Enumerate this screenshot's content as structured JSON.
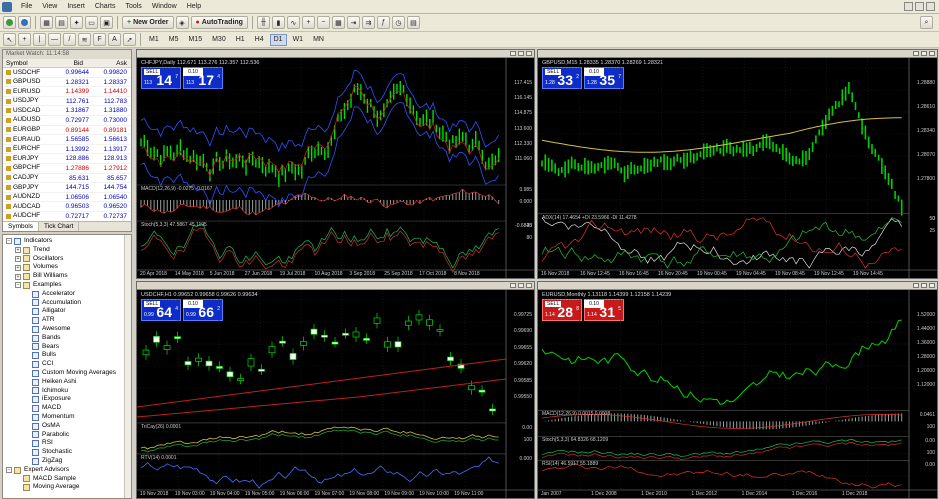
{
  "menu": [
    "File",
    "View",
    "Insert",
    "Charts",
    "Tools",
    "Window",
    "Help"
  ],
  "toolbar": {
    "new_order": "New Order",
    "autotrading": "AutoTrading"
  },
  "timeframes": [
    "M1",
    "M5",
    "M15",
    "M30",
    "H1",
    "H4",
    "D1",
    "W1",
    "MN"
  ],
  "timeframe_active": "D1",
  "market_watch": {
    "title": "Market Watch: 11:14:58",
    "col_symbol": "Symbol",
    "col_bid": "Bid",
    "col_ask": "Ask",
    "rows": [
      {
        "s": "USDCHF",
        "b": "0.99644",
        "a": "0.99820",
        "c": "#0000c0"
      },
      {
        "s": "GBPUSD",
        "b": "1.28321",
        "a": "1.28337",
        "c": "#0000c0"
      },
      {
        "s": "EURUSD",
        "b": "1.14399",
        "a": "1.14410",
        "c": "#d00000"
      },
      {
        "s": "USDJPY",
        "b": "112.761",
        "a": "112.783",
        "c": "#0000c0"
      },
      {
        "s": "USDCAD",
        "b": "1.31867",
        "a": "1.31880",
        "c": "#0000c0"
      },
      {
        "s": "AUDUSD",
        "b": "0.72977",
        "a": "0.73000",
        "c": "#0000c0"
      },
      {
        "s": "EURGBP",
        "b": "0.89144",
        "a": "0.89181",
        "c": "#d00000"
      },
      {
        "s": "EURAUD",
        "b": "1.56585",
        "a": "1.56613",
        "c": "#0000c0"
      },
      {
        "s": "EURCHF",
        "b": "1.13992",
        "a": "1.13917",
        "c": "#0000c0"
      },
      {
        "s": "EURJPY",
        "b": "128.886",
        "a": "128.913",
        "c": "#0000c0"
      },
      {
        "s": "GBPCHF",
        "b": "1.27886",
        "a": "1.27912",
        "c": "#d00000"
      },
      {
        "s": "CADJPY",
        "b": "85.631",
        "a": "85.657",
        "c": "#0000c0"
      },
      {
        "s": "GBPJPY",
        "b": "144.715",
        "a": "144.754",
        "c": "#0000c0"
      },
      {
        "s": "AUDNZD",
        "b": "1.06506",
        "a": "1.06540",
        "c": "#0000c0"
      },
      {
        "s": "AUDCAD",
        "b": "0.96503",
        "a": "0.96520",
        "c": "#0000c0"
      },
      {
        "s": "AUDCHF",
        "b": "0.72717",
        "a": "0.72737",
        "c": "#0000c0"
      }
    ],
    "tabs": [
      "Symbols",
      "Tick Chart"
    ]
  },
  "navigator": {
    "items": [
      {
        "t": "Indicators",
        "lvl": 0,
        "box": "-",
        "ind": true
      },
      {
        "t": "Trend",
        "lvl": 1,
        "box": "+"
      },
      {
        "t": "Oscillators",
        "lvl": 1,
        "box": "+"
      },
      {
        "t": "Volumes",
        "lvl": 1,
        "box": "+"
      },
      {
        "t": "Bill Williams",
        "lvl": 1,
        "box": "+"
      },
      {
        "t": "Examples",
        "lvl": 1,
        "box": "-"
      },
      {
        "t": "Accelerator",
        "lvl": 2,
        "ind": true
      },
      {
        "t": "Accumulation",
        "lvl": 2,
        "ind": true
      },
      {
        "t": "Alligator",
        "lvl": 2,
        "ind": true
      },
      {
        "t": "ATR",
        "lvl": 2,
        "ind": true
      },
      {
        "t": "Awesome",
        "lvl": 2,
        "ind": true
      },
      {
        "t": "Bands",
        "lvl": 2,
        "ind": true
      },
      {
        "t": "Bears",
        "lvl": 2,
        "ind": true
      },
      {
        "t": "Bulls",
        "lvl": 2,
        "ind": true
      },
      {
        "t": "CCI",
        "lvl": 2,
        "ind": true
      },
      {
        "t": "Custom Moving Averages",
        "lvl": 2,
        "ind": true
      },
      {
        "t": "Heiken Ashi",
        "lvl": 2,
        "ind": true
      },
      {
        "t": "Ichimoku",
        "lvl": 2,
        "ind": true
      },
      {
        "t": "iExposure",
        "lvl": 2,
        "ind": true
      },
      {
        "t": "MACD",
        "lvl": 2,
        "ind": true
      },
      {
        "t": "Momentum",
        "lvl": 2,
        "ind": true
      },
      {
        "t": "OsMA",
        "lvl": 2,
        "ind": true
      },
      {
        "t": "Parabolic",
        "lvl": 2,
        "ind": true
      },
      {
        "t": "RSI",
        "lvl": 2,
        "ind": true
      },
      {
        "t": "Stochastic",
        "lvl": 2,
        "ind": true
      },
      {
        "t": "ZigZag",
        "lvl": 2,
        "ind": true
      },
      {
        "t": "Expert Advisors",
        "lvl": 0,
        "box": "-"
      },
      {
        "t": "MACD Sample",
        "lvl": 1
      },
      {
        "t": "Moving Average",
        "lvl": 1
      }
    ]
  },
  "charts": [
    {
      "id": "chfjpy",
      "symbol": "CHFJPY,Daily  112.671 113.276 112.357 112.536",
      "sell_label": "SELL",
      "buy_label": "BUY",
      "lot": "0.10",
      "sell_small": "113",
      "sell_big": "14",
      "sell_sup": "7",
      "buy_small": "113",
      "buy_big": "17",
      "buy_sup": "4",
      "red": false,
      "ind1": "MACD(12,26,9) -0.0275 -0.0167",
      "ind2": "Stoch(5,3,3) 47.5867 45.1195",
      "y": [
        "117.415",
        "116.145",
        "114.875",
        "113.600",
        "112.330",
        "111.060"
      ],
      "x": [
        "20 Apr 2018",
        "14 May 2018",
        "5 Jun 2018",
        "27 Jun 2018",
        "19 Jul 2018",
        "10 Aug 2018",
        "3 Sep 2018",
        "25 Sep 2018",
        "17 Oct 2018",
        "8 Nov 2018"
      ],
      "ind_y": [
        "0.985",
        "0.000",
        "-0.6845",
        "80",
        "20"
      ]
    },
    {
      "id": "gbpusd",
      "symbol": "GBPUSD,M15  1.28335 1.28370 1.28269 1.28321",
      "sell_label": "SELL",
      "buy_label": "BUY",
      "lot": "0.10",
      "sell_small": "1.28",
      "sell_big": "33",
      "sell_sup": "2",
      "buy_small": "1.28",
      "buy_big": "35",
      "buy_sup": "7",
      "red": false,
      "ind1": "ADX(14) 17.4654 +DI 23.5966 -DI 11.4278",
      "ind2": "",
      "y": [
        "1.28880",
        "1.28610",
        "1.28340",
        "1.28070",
        "1.27800"
      ],
      "x": [
        "16 Nov 2018",
        "16 Nov 12:45",
        "16 Nov 16:45",
        "16 Nov 20:45",
        "19 Nov 00:45",
        "19 Nov 04:45",
        "19 Nov 08:45",
        "19 Nov 12:45",
        "19 Nov 14:45"
      ],
      "ind_y": [
        "50",
        "25",
        "0"
      ]
    },
    {
      "id": "usdchf",
      "symbol": "USDCHF,H1  0.99652 0.99658 0.99626 0.99634",
      "sell_label": "SELL",
      "buy_label": "BUY",
      "lot": "0.10",
      "sell_small": "0.99",
      "sell_big": "64",
      "sell_sup": "4",
      "buy_small": "0.99",
      "buy_big": "66",
      "buy_sup": "2",
      "red": false,
      "ind1": "TriCay(26) 0.0001",
      "ind2": "RTV(14) 0.0001",
      "y": [
        "0.99725",
        "0.99690",
        "0.99655",
        "0.99620",
        "0.99585",
        "0.99550"
      ],
      "x": [
        "19 Nov 2018",
        "19 Nov 03:00",
        "19 Nov 04:00",
        "19 Nov 05:00",
        "19 Nov 06:00",
        "19 Nov 07:00",
        "19 Nov 08:00",
        "19 Nov 09:00",
        "19 Nov 10:00",
        "19 Nov 11:00"
      ],
      "ind_y": [
        "0.00",
        "100",
        "0.000"
      ]
    },
    {
      "id": "eurusd",
      "symbol": "EURUSD,Monthly  1.13118 1.14399 1.12158 1.14239",
      "sell_label": "SELL",
      "buy_label": "BUY",
      "lot": "0.10",
      "sell_small": "1.14",
      "sell_big": "28",
      "sell_sup": "8",
      "buy_small": "1.14",
      "buy_big": "31",
      "buy_sup": "5",
      "red": true,
      "ind1": "MACD(12,26,9) 0.0015 0.0008",
      "ind2": "Stoch(5,3,3) 64.8326 68.1209",
      "ind3": "RSI(14) 46.5917 55.1889",
      "y": [
        "1.52000",
        "1.44000",
        "1.36000",
        "1.28000",
        "1.20000",
        "1.12000"
      ],
      "x": [
        "Jan 2007",
        "1 Dec 2008",
        "1 Dec 2010",
        "1 Dec 2012",
        "1 Dec 2014",
        "1 Dec 2016",
        "1 Dec 2018"
      ],
      "ind_y": [
        "0.0461",
        "100",
        "0.00",
        "100",
        "0.00"
      ]
    }
  ]
}
